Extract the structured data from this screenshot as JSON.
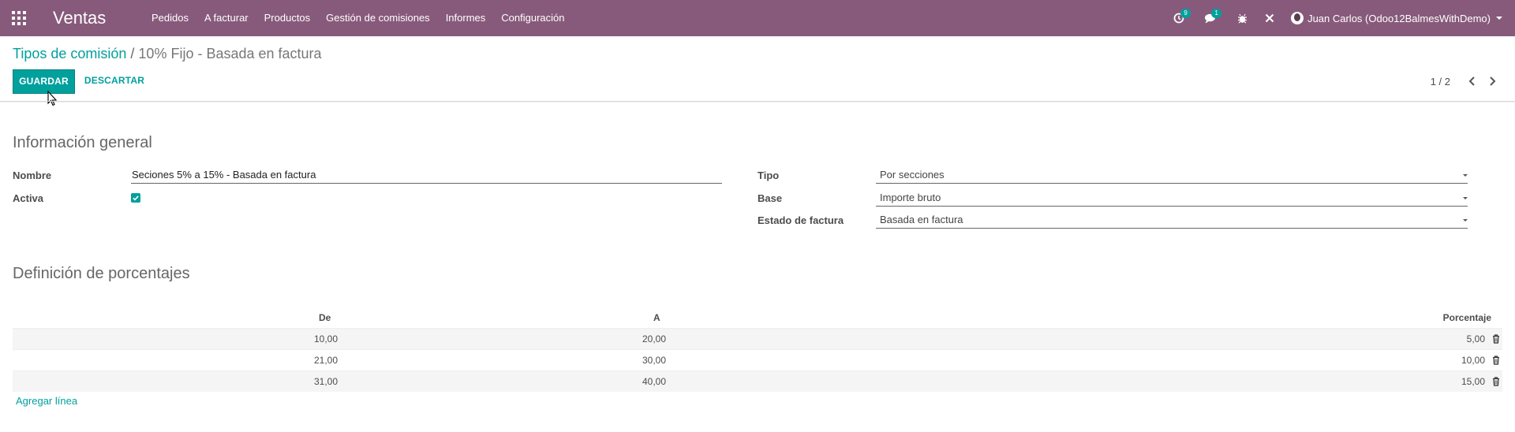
{
  "navbar": {
    "app_name": "Ventas",
    "menu": [
      "Pedidos",
      "A facturar",
      "Productos",
      "Gestión de comisiones",
      "Informes",
      "Configuración"
    ],
    "activity_count": "9",
    "messages_count": "1",
    "user_name": "Juan Carlos (Odoo12BalmesWithDemo)"
  },
  "breadcrumb": {
    "parent": "Tipos de comisión",
    "separator": "/",
    "current": "10% Fijo - Basada en factura"
  },
  "buttons": {
    "save": "GUARDAR",
    "discard": "DESCARTAR"
  },
  "pager": {
    "value": "1 / 2"
  },
  "form": {
    "general_title": "Información general",
    "name_label": "Nombre",
    "name_value": "Seciones 5% a 15% - Basada en factura",
    "active_label": "Activa",
    "active_checked": true,
    "type_label": "Tipo",
    "type_value": "Por secciones",
    "base_label": "Base",
    "base_value": "Importe bruto",
    "invoice_state_label": "Estado de factura",
    "invoice_state_value": "Basada en factura",
    "percentages_title": "Definición de porcentajes"
  },
  "table": {
    "headers": {
      "from": "De",
      "to": "A",
      "percent": "Porcentaje"
    },
    "rows": [
      {
        "from": "10,00",
        "to": "20,00",
        "percent": "5,00"
      },
      {
        "from": "21,00",
        "to": "30,00",
        "percent": "10,00"
      },
      {
        "from": "31,00",
        "to": "40,00",
        "percent": "15,00"
      }
    ],
    "add_line": "Agregar línea"
  },
  "colors": {
    "navbar": "#875a7b",
    "accent": "#00a09d"
  },
  "icons": {
    "apps": "apps-grid-icon",
    "activity": "clock-icon",
    "messages": "chat-icon",
    "debug": "bug-icon",
    "close": "close-icon",
    "delete": "trash-icon"
  }
}
